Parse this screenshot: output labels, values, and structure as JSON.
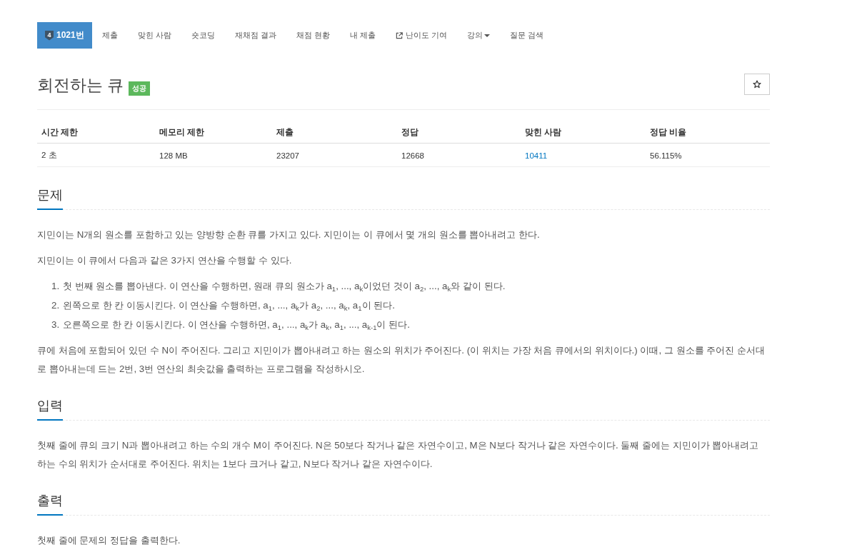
{
  "nav": {
    "tabs": [
      {
        "kind": "problem",
        "tier": "4",
        "label": "1021번",
        "selected": true
      },
      {
        "kind": "plain",
        "label": "제출",
        "selected": false
      },
      {
        "kind": "plain",
        "label": "맞힌 사람",
        "selected": false
      },
      {
        "kind": "plain",
        "label": "숏코딩",
        "selected": false
      },
      {
        "kind": "plain",
        "label": "재채점 결과",
        "selected": false
      },
      {
        "kind": "plain",
        "label": "채점 현황",
        "selected": false
      },
      {
        "kind": "plain",
        "label": "내 제출",
        "selected": false
      },
      {
        "kind": "external",
        "label": "난이도 기여",
        "selected": false
      },
      {
        "kind": "dropdown",
        "label": "강의",
        "selected": false
      },
      {
        "kind": "plain",
        "label": "질문 검색",
        "selected": false
      }
    ]
  },
  "title": {
    "text": "회전하는 큐",
    "status_badge": "성공"
  },
  "info_table": {
    "columns": [
      "시간 제한",
      "메모리 제한",
      "제출",
      "정답",
      "맞힌 사람",
      "정답 비율"
    ],
    "rows": [
      [
        {
          "kind": "text",
          "text": "2 초"
        },
        {
          "kind": "text",
          "text": "128 MB"
        },
        {
          "kind": "text",
          "text": "23207"
        },
        {
          "kind": "text",
          "text": "12668"
        },
        {
          "kind": "link",
          "text": "10411"
        },
        {
          "kind": "text",
          "text": "56.115%"
        }
      ]
    ]
  },
  "sections": [
    {
      "heading": "문제",
      "blocks": [
        {
          "kind": "paragraph",
          "text": "지민이는 N개의 원소를 포함하고 있는 양방향 순환 큐를 가지고 있다. 지민이는 이 큐에서 몇 개의 원소를 뽑아내려고 한다."
        },
        {
          "kind": "paragraph",
          "text": "지민이는 이 큐에서 다음과 같은 3가지 연산을 수행할 수 있다."
        },
        {
          "kind": "list",
          "items": [
            {
              "number": "1.",
              "text": "첫 번째 원소를 뽑아낸다. 이 연산을 수행하면, 원래 큐의 원소가 a$_{1}$, ..., a$_{k}$이었던 것이 a$_{2}$, ..., a$_{k}$와 같이 된다."
            },
            {
              "number": "2.",
              "text": "왼쪽으로 한 칸 이동시킨다. 이 연산을 수행하면, a$_{1}$, ..., a$_{k}$가 a$_{2}$, ..., a$_{k}$, a$_{1}$이 된다."
            },
            {
              "number": "3.",
              "text": "오른쪽으로 한 칸 이동시킨다. 이 연산을 수행하면, a$_{1}$, ..., a$_{k}$가 a$_{k}$, a$_{1}$, ..., a$_{k-1}$이 된다."
            }
          ]
        },
        {
          "kind": "paragraph",
          "text": "큐에 처음에 포함되어 있던 수 N이 주어진다. 그리고 지민이가 뽑아내려고 하는 원소의 위치가 주어진다. (이 위치는 가장 처음 큐에서의 위치이다.) 이때, 그 원소를 주어진 순서대로 뽑아내는데 드는 2번, 3번 연산의 최솟값을 출력하는 프로그램을 작성하시오."
        }
      ]
    },
    {
      "heading": "입력",
      "blocks": [
        {
          "kind": "paragraph",
          "text": "첫째 줄에 큐의 크기 N과 뽑아내려고 하는 수의 개수 M이 주어진다. N은 50보다 작거나 같은 자연수이고, M은 N보다 작거나 같은 자연수이다. 둘째 줄에는 지민이가 뽑아내려고 하는 수의 위치가 순서대로 주어진다. 위치는 1보다 크거나 같고, N보다 작거나 같은 자연수이다."
        }
      ]
    },
    {
      "heading": "출력",
      "blocks": [
        {
          "kind": "paragraph",
          "text": "첫째 줄에 문제의 정답을 출력한다."
        }
      ]
    }
  ]
}
